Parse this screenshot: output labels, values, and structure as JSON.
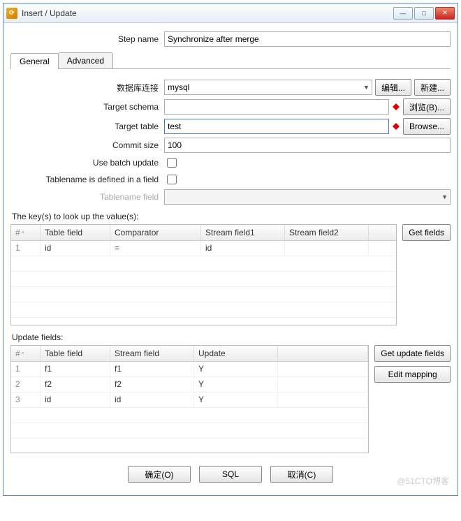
{
  "window": {
    "title": "Insert / Update"
  },
  "step": {
    "label": "Step name",
    "value": "Synchronize after merge"
  },
  "tabs": {
    "general": "General",
    "advanced": "Advanced"
  },
  "form": {
    "db_label": "数据库连接",
    "db_value": "mysql",
    "edit_btn": "编辑...",
    "new_btn": "新建...",
    "schema_label": "Target schema",
    "schema_value": "",
    "browseB_btn": "浏览(B)...",
    "table_label": "Target table",
    "table_value": "test",
    "browse_btn": "Browse...",
    "commit_label": "Commit size",
    "commit_value": "100",
    "batch_label": "Use batch update",
    "inField_label": "Tablename is defined in a field",
    "tnField_label": "Tablename field"
  },
  "keys": {
    "section": "The key(s) to look up the value(s):",
    "headers": {
      "idx": "#",
      "tf": "Table field",
      "cmp": "Comparator",
      "sf1": "Stream field1",
      "sf2": "Stream field2"
    },
    "rows": [
      {
        "idx": "1",
        "tf": "id",
        "cmp": "=",
        "sf1": "id",
        "sf2": ""
      }
    ],
    "get_btn": "Get fields"
  },
  "updates": {
    "section": "Update fields:",
    "headers": {
      "idx": "#",
      "tf": "Table field",
      "sf": "Stream field",
      "upd": "Update"
    },
    "rows": [
      {
        "idx": "1",
        "tf": "f1",
        "sf": "f1",
        "upd": "Y"
      },
      {
        "idx": "2",
        "tf": "f2",
        "sf": "f2",
        "upd": "Y"
      },
      {
        "idx": "3",
        "tf": "id",
        "sf": "id",
        "upd": "Y"
      }
    ],
    "get_btn": "Get update fields",
    "edit_btn": "Edit mapping"
  },
  "footer": {
    "ok": "确定(O)",
    "sql": "SQL",
    "cancel": "取消(C)"
  },
  "watermark": "@51CTO博客"
}
